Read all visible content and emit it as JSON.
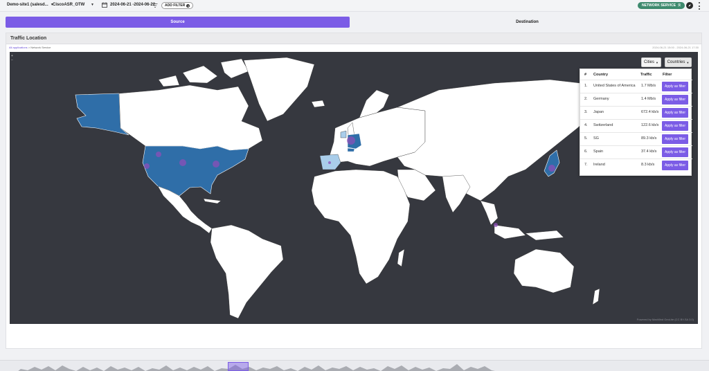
{
  "topbar": {
    "site_select": "Demo-site1 (salesd...",
    "device_select": "CiscoASR_OTW",
    "date_range": "2024-06-21 -2024-06-22",
    "add_filter_label": "ADD FILTER",
    "service_badge": "NETWORK SERVICE"
  },
  "tabs": [
    {
      "label": "Source",
      "active": true
    },
    {
      "label": "Destination",
      "active": false
    }
  ],
  "panel": {
    "title": "Traffic Location",
    "breadcrumb_link": "All applications",
    "breadcrumb_sep": ">",
    "breadcrumb_current": "Network Service",
    "time_range": "2024-06-21 15:00 - 2024-06-21 17:30"
  },
  "map": {
    "cities_button": "Cities",
    "countries_button": "Countries",
    "zoom_in": "+",
    "zoom_out": "−",
    "attribution": "Powered by MaxMind GeoLite (CC BY-SA 3.0)",
    "ocean_color": "#36383f",
    "land_color": "#ffffff",
    "highlight_color": "#2f6ea8",
    "light_highlight_color": "#a9cdea",
    "city_dot_color": "#8e4fb8"
  },
  "countries_table": {
    "headers": [
      "#",
      "Country",
      "Traffic",
      "Filter"
    ],
    "rows": [
      {
        "rank": "1.",
        "country": "United States of America",
        "traffic": "1.7 Mb/s",
        "action": "Apply as filter"
      },
      {
        "rank": "2.",
        "country": "Germany",
        "traffic": "1.4 Mb/s",
        "action": "Apply as filter"
      },
      {
        "rank": "3.",
        "country": "Japan",
        "traffic": "672.4 kb/s",
        "action": "Apply as filter"
      },
      {
        "rank": "4.",
        "country": "Switzerland",
        "traffic": "122.6 kb/s",
        "action": "Apply as filter"
      },
      {
        "rank": "5.",
        "country": "SG",
        "traffic": "89.3 kb/s",
        "action": "Apply as filter"
      },
      {
        "rank": "6.",
        "country": "Spain",
        "traffic": "37.4 kb/s",
        "action": "Apply as filter"
      },
      {
        "rank": "7.",
        "country": "Ireland",
        "traffic": "8.3 kb/s",
        "action": "Apply as filter"
      }
    ]
  }
}
